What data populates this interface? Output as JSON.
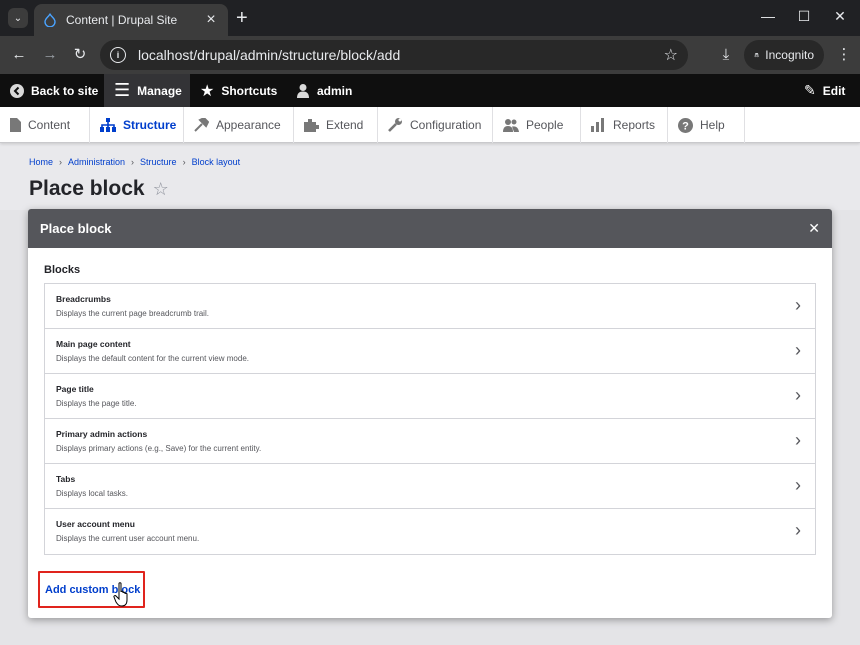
{
  "browser": {
    "tab_title": "Content | Drupal Site",
    "url": "localhost/drupal/admin/structure/block/add",
    "incognito_label": "Incognito",
    "icons": [
      "chevron-down-icon",
      "drupal-favicon",
      "close-icon",
      "plus-icon",
      "minimize-icon",
      "maximize-icon",
      "close-window-icon",
      "back-icon",
      "forward-icon",
      "reload-icon",
      "site-info-icon",
      "bookmark-star-icon",
      "download-icon",
      "incognito-icon",
      "more-icon"
    ]
  },
  "toolbar": {
    "back_to_site": "Back to site",
    "manage": "Manage",
    "shortcuts": "Shortcuts",
    "user": "admin",
    "edit": "Edit"
  },
  "tray": {
    "items": [
      {
        "label": "Content",
        "icon": "content-icon"
      },
      {
        "label": "Structure",
        "icon": "structure-icon"
      },
      {
        "label": "Appearance",
        "icon": "appearance-icon"
      },
      {
        "label": "Extend",
        "icon": "extend-icon"
      },
      {
        "label": "Configuration",
        "icon": "configuration-icon"
      },
      {
        "label": "People",
        "icon": "people-icon"
      },
      {
        "label": "Reports",
        "icon": "reports-icon"
      },
      {
        "label": "Help",
        "icon": "help-icon"
      }
    ]
  },
  "breadcrumb": [
    "Home",
    "Administration",
    "Structure",
    "Block layout"
  ],
  "page_title": "Place block",
  "dialog": {
    "title": "Place block",
    "section": "Blocks",
    "blocks": [
      {
        "name": "Breadcrumbs",
        "description": "Displays the current page breadcrumb trail."
      },
      {
        "name": "Main page content",
        "description": "Displays the default content for the current view mode."
      },
      {
        "name": "Page title",
        "description": "Displays the page title."
      },
      {
        "name": "Primary admin actions",
        "description": "Displays primary actions (e.g., Save) for the current entity."
      },
      {
        "name": "Tabs",
        "description": "Displays local tasks."
      },
      {
        "name": "User account menu",
        "description": "Displays the current user account menu."
      }
    ],
    "add_custom_block": "Add custom block"
  },
  "colors": {
    "link_blue": "#003ecc",
    "highlight_red": "#e0241d",
    "dialog_header": "#55565b"
  }
}
